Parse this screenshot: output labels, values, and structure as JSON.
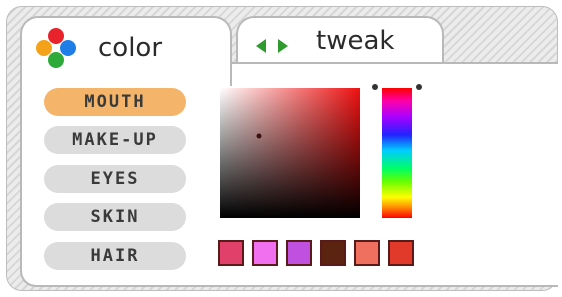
{
  "tabs": {
    "color": {
      "label": "color"
    },
    "tweak": {
      "label": "tweak"
    }
  },
  "logo": {
    "dots": [
      "#e8232b",
      "#1f7de8",
      "#2eaa3a",
      "#f4a21a"
    ]
  },
  "categories": [
    {
      "label": "MOUTH",
      "active": true
    },
    {
      "label": "MAKE-UP",
      "active": false
    },
    {
      "label": "EYES",
      "active": false
    },
    {
      "label": "SKIN",
      "active": false
    },
    {
      "label": "HAIR",
      "active": false
    }
  ],
  "color_picker": {
    "hue_color": "#ee1111",
    "swatches": [
      "#e0406a",
      "#f070f0",
      "#c050e0",
      "#5a2410",
      "#f07060",
      "#e23a2a"
    ]
  },
  "colors": {
    "active_category": "#f4b56a",
    "inactive_category": "#dcdcdc",
    "tab_arrows": "#2f9b2f"
  }
}
